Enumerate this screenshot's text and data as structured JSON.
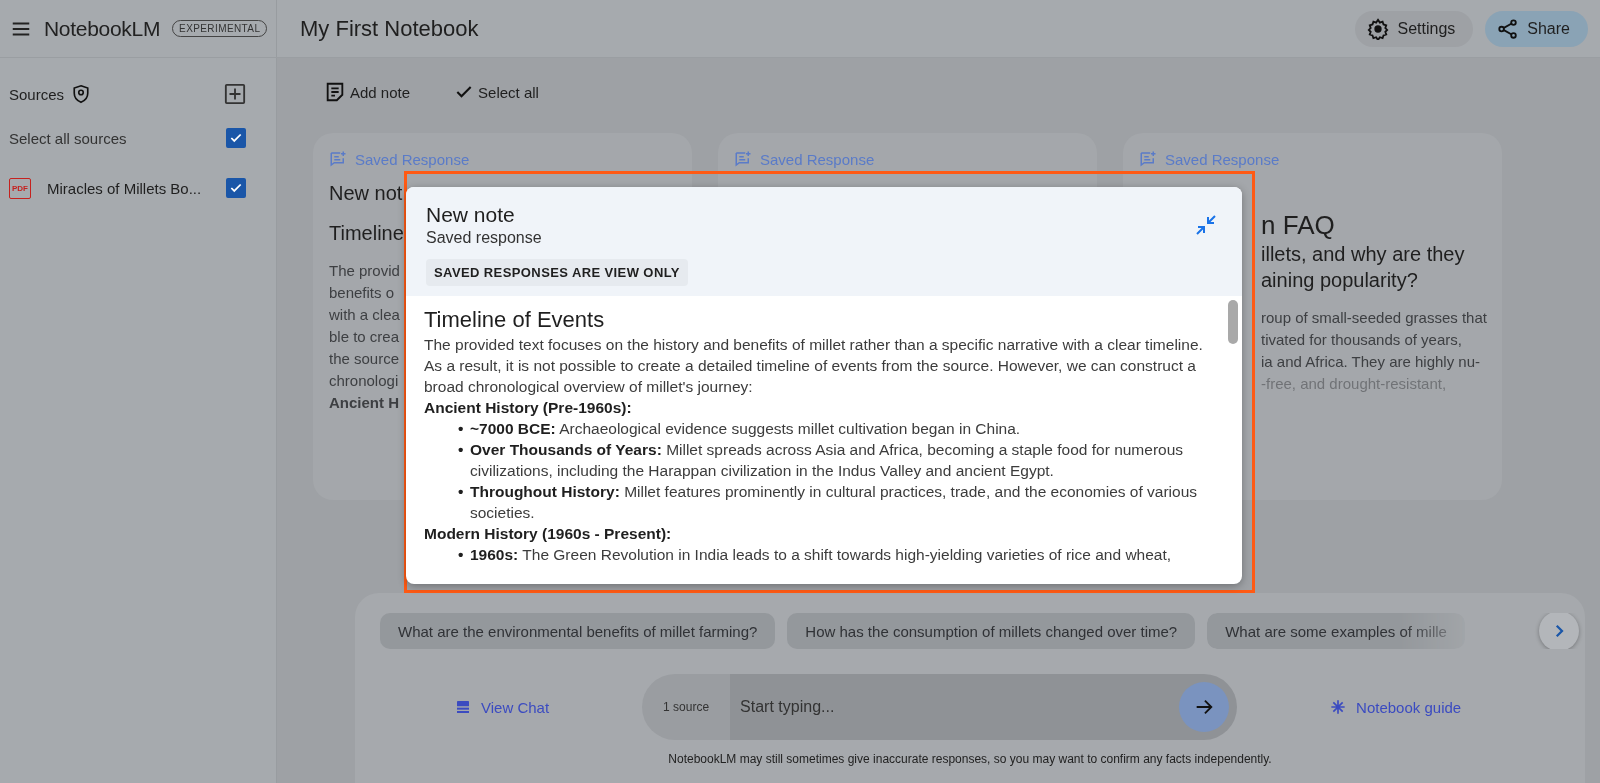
{
  "app": {
    "name": "NotebookLM",
    "badge": "EXPERIMENTAL"
  },
  "notebook_title": "My First Notebook",
  "header_buttons": [
    {
      "label": "Settings",
      "kind": "settings"
    },
    {
      "label": "Share",
      "kind": "share"
    }
  ],
  "sources": {
    "title": "Sources",
    "select_all": {
      "label": "Select all sources",
      "checked": true
    },
    "items": [
      {
        "name": "Miracles of Millets Bo...",
        "file_badge": "PDF",
        "checked": true
      }
    ]
  },
  "toolbar": [
    {
      "label": "Add note",
      "kind": "add-note"
    },
    {
      "label": "Select all",
      "kind": "select"
    }
  ],
  "notes": [
    {
      "tag": "Saved Response",
      "lines": [
        {
          "kind": "title",
          "text": "New not"
        },
        {
          "kind": "heading",
          "text": "Timeline"
        },
        {
          "kind": "body",
          "text": "The provid"
        },
        {
          "kind": "body",
          "text": "benefits o"
        },
        {
          "kind": "body",
          "text": "with a clea"
        },
        {
          "kind": "body",
          "text": "ble to crea"
        },
        {
          "kind": "body",
          "text": "the source"
        },
        {
          "kind": "body",
          "text": "chronologi"
        },
        {
          "kind": "bold",
          "text": "Ancient H"
        }
      ]
    },
    {
      "tag": "Saved Response"
    },
    {
      "tag": "Saved Response",
      "lines": [
        {
          "kind": "big",
          "text": "n FAQ"
        },
        {
          "kind": "question",
          "text": "illets, and why are they"
        },
        {
          "kind": "question",
          "text": "aining popularity?"
        },
        {
          "kind": "body",
          "text": "roup of small-seeded grasses that"
        },
        {
          "kind": "body",
          "text": "tivated for thousands of years,"
        },
        {
          "kind": "body",
          "text": "ia and Africa. They are highly nu-"
        },
        {
          "kind": "body",
          "text": "-free, and drought-resistant,"
        }
      ]
    }
  ],
  "modal": {
    "title": "New note",
    "subtitle": "Saved response",
    "notice": "SAVED RESPONSES ARE VIEW ONLY",
    "heading": "Timeline of Events",
    "intro": "The provided text focuses on the history and benefits of millet rather than a specific narrative with a clear timeline. As a result, it is not possible to create a detailed timeline of events from the source. However, we can construct a broad chronological overview of millet's journey:",
    "sections": [
      {
        "title": "Ancient History (Pre-1960s):",
        "items": [
          {
            "bullet": "•",
            "label": "~7000 BCE:",
            "text": "Archaeological evidence suggests millet cultivation began in China."
          },
          {
            "bullet": "•",
            "label": "Over Thousands of Years:",
            "text": "Millet spreads across Asia and Africa, becoming a staple food for numerous civilizations, including the Harappan civilization in the Indus Valley and ancient Egypt."
          },
          {
            "bullet": "•",
            "label": "Throughout History:",
            "text": "Millet features prominently in cultural practices, trade, and the economies of various societies."
          }
        ]
      },
      {
        "title": "Modern History (1960s - Present):",
        "items": [
          {
            "bullet": "•",
            "label": "1960s:",
            "text": "The Green Revolution in India leads to a shift towards high-yielding varieties of rice and wheat,"
          }
        ]
      }
    ]
  },
  "chat": {
    "suggestions": [
      "What are the environmental benefits of millet farming?",
      "How has the consumption of millets changed over time?",
      "What are some examples of mille"
    ],
    "view_chat": "View Chat",
    "source_count": "1 source",
    "placeholder": "Start typing...",
    "guide": "Notebook guide",
    "disclaimer": "NotebookLM may still sometimes give inaccurate responses, so you may want to confirm any facts independently."
  }
}
